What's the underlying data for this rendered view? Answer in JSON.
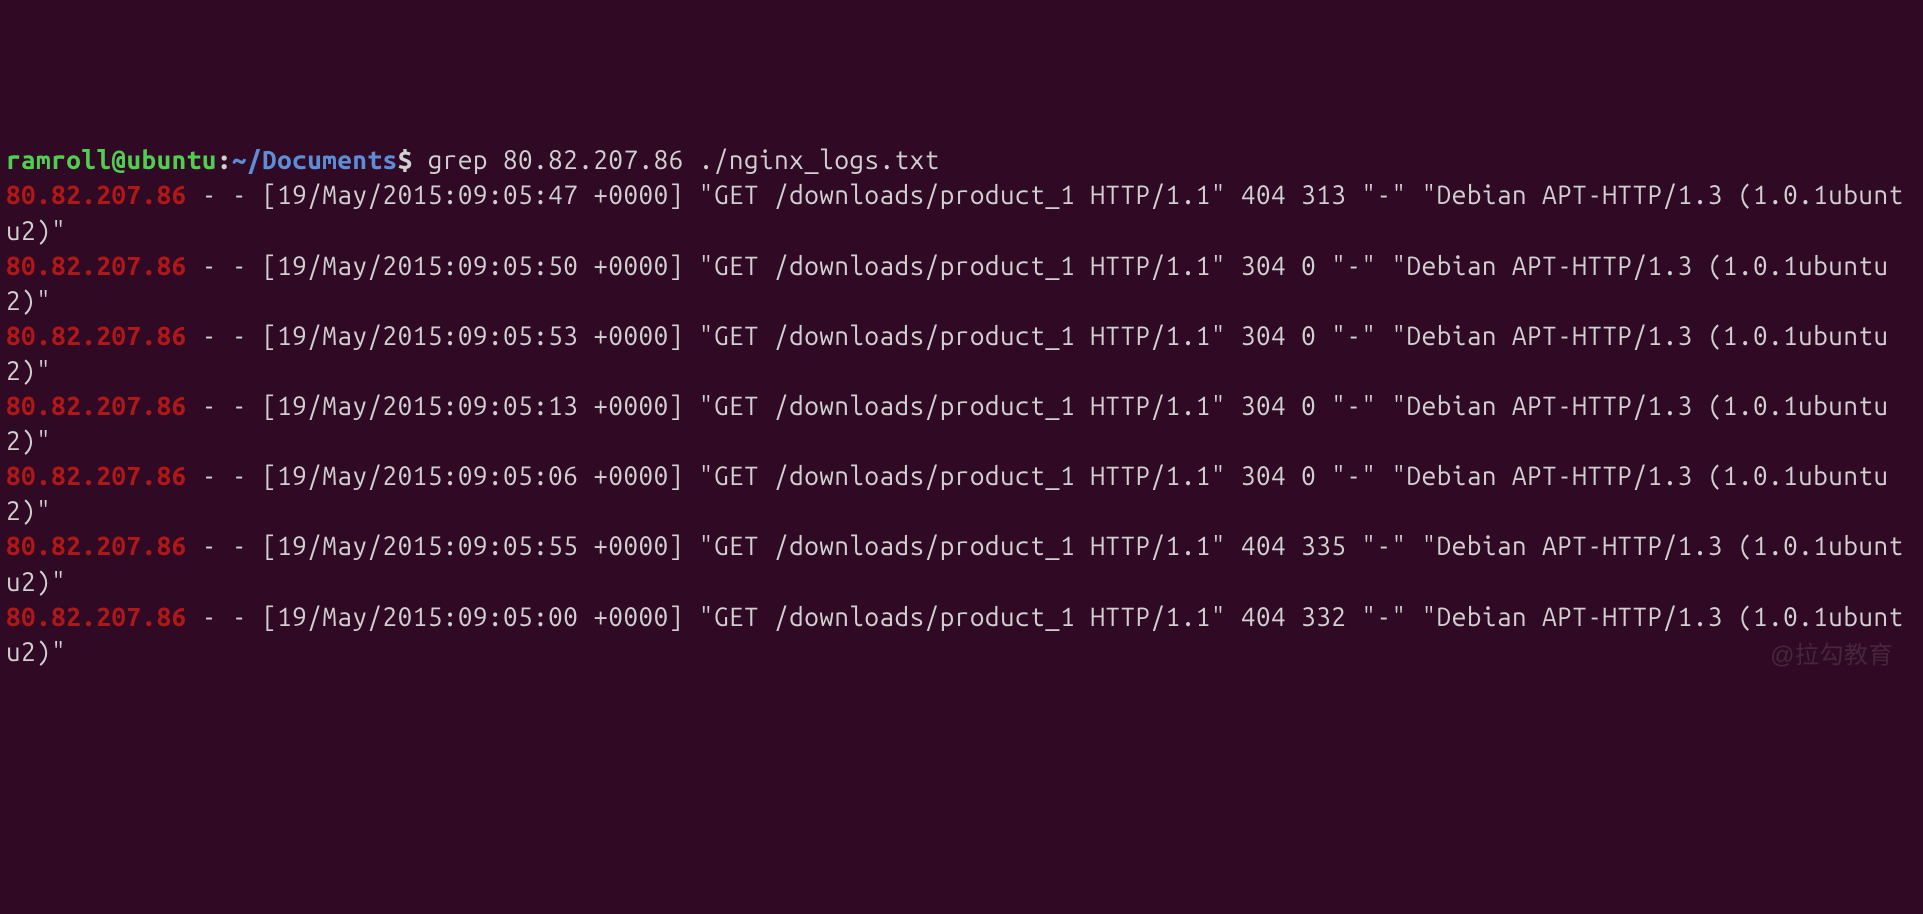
{
  "prompt": {
    "user": "ramroll@ubuntu",
    "colon": ":",
    "path": "~/Documents",
    "dollar": "$"
  },
  "command": " grep 80.82.207.86 ./nginx_logs.txt",
  "log_entries": [
    {
      "ip": "80.82.207.86",
      "rest1": " - - [19/May/2015:09:05:47 +0000] \"GET /downloads/product_1 HTTP/1.1\" 404 313 \"-\" \"Debian APT-HTTP/1.3 (1.0.1ubuntu2)\""
    },
    {
      "ip": "80.82.207.86",
      "rest1": " - - [19/May/2015:09:05:50 +0000] \"GET /downloads/product_1 HTTP/1.1\" 304 0 \"-\" \"Debian APT-HTTP/1.3 (1.0.1ubuntu2)\""
    },
    {
      "ip": "80.82.207.86",
      "rest1": " - - [19/May/2015:09:05:53 +0000] \"GET /downloads/product_1 HTTP/1.1\" 304 0 \"-\" \"Debian APT-HTTP/1.3 (1.0.1ubuntu2)\""
    },
    {
      "ip": "80.82.207.86",
      "rest1": " - - [19/May/2015:09:05:13 +0000] \"GET /downloads/product_1 HTTP/1.1\" 304 0 \"-\" \"Debian APT-HTTP/1.3 (1.0.1ubuntu2)\""
    },
    {
      "ip": "80.82.207.86",
      "rest1": " - - [19/May/2015:09:05:06 +0000] \"GET /downloads/product_1 HTTP/1.1\" 304 0 \"-\" \"Debian APT-HTTP/1.3 (1.0.1ubuntu2)\""
    },
    {
      "ip": "80.82.207.86",
      "rest1": " - - [19/May/2015:09:05:55 +0000] \"GET /downloads/product_1 HTTP/1.1\" 404 335 \"-\" \"Debian APT-HTTP/1.3 (1.0.1ubuntu2)\""
    },
    {
      "ip": "80.82.207.86",
      "rest1": " - - [19/May/2015:09:05:00 +0000] \"GET /downloads/product_1 HTTP/1.1\" 404 332 \"-\" \"Debian APT-HTTP/1.3 (1.0.1ubuntu2)\""
    }
  ],
  "watermark": "@拉勾教育"
}
